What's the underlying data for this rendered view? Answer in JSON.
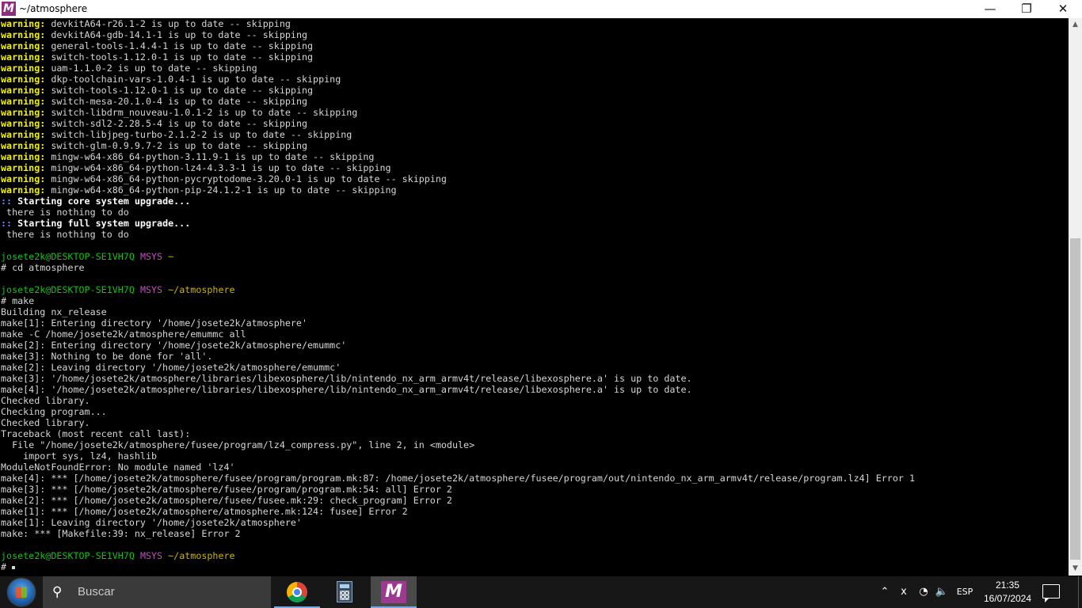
{
  "window": {
    "title": "~/atmosphere",
    "app_icon": "msys2-icon",
    "controls": {
      "minimize": "—",
      "maximize": "❐",
      "close": "✕"
    }
  },
  "terminal": {
    "lines": [
      {
        "parts": [
          {
            "cls": "w",
            "text": "warning:"
          },
          {
            "cls": "",
            "text": " devkitA64-r26.1-2 is up to date -- skipping"
          }
        ]
      },
      {
        "parts": [
          {
            "cls": "w",
            "text": "warning:"
          },
          {
            "cls": "",
            "text": " devkitA64-gdb-14.1-1 is up to date -- skipping"
          }
        ]
      },
      {
        "parts": [
          {
            "cls": "w",
            "text": "warning:"
          },
          {
            "cls": "",
            "text": " general-tools-1.4.4-1 is up to date -- skipping"
          }
        ]
      },
      {
        "parts": [
          {
            "cls": "w",
            "text": "warning:"
          },
          {
            "cls": "",
            "text": " switch-tools-1.12.0-1 is up to date -- skipping"
          }
        ]
      },
      {
        "parts": [
          {
            "cls": "w",
            "text": "warning:"
          },
          {
            "cls": "",
            "text": " uam-1.1.0-2 is up to date -- skipping"
          }
        ]
      },
      {
        "parts": [
          {
            "cls": "w",
            "text": "warning:"
          },
          {
            "cls": "",
            "text": " dkp-toolchain-vars-1.0.4-1 is up to date -- skipping"
          }
        ]
      },
      {
        "parts": [
          {
            "cls": "w",
            "text": "warning:"
          },
          {
            "cls": "",
            "text": " switch-tools-1.12.0-1 is up to date -- skipping"
          }
        ]
      },
      {
        "parts": [
          {
            "cls": "w",
            "text": "warning:"
          },
          {
            "cls": "",
            "text": " switch-mesa-20.1.0-4 is up to date -- skipping"
          }
        ]
      },
      {
        "parts": [
          {
            "cls": "w",
            "text": "warning:"
          },
          {
            "cls": "",
            "text": " switch-libdrm_nouveau-1.0.1-2 is up to date -- skipping"
          }
        ]
      },
      {
        "parts": [
          {
            "cls": "w",
            "text": "warning:"
          },
          {
            "cls": "",
            "text": " switch-sdl2-2.28.5-4 is up to date -- skipping"
          }
        ]
      },
      {
        "parts": [
          {
            "cls": "w",
            "text": "warning:"
          },
          {
            "cls": "",
            "text": " switch-libjpeg-turbo-2.1.2-2 is up to date -- skipping"
          }
        ]
      },
      {
        "parts": [
          {
            "cls": "w",
            "text": "warning:"
          },
          {
            "cls": "",
            "text": " switch-glm-0.9.9.7-2 is up to date -- skipping"
          }
        ]
      },
      {
        "parts": [
          {
            "cls": "w",
            "text": "warning:"
          },
          {
            "cls": "",
            "text": " mingw-w64-x86_64-python-3.11.9-1 is up to date -- skipping"
          }
        ]
      },
      {
        "parts": [
          {
            "cls": "w",
            "text": "warning:"
          },
          {
            "cls": "",
            "text": " mingw-w64-x86_64-python-lz4-4.3.3-1 is up to date -- skipping"
          }
        ]
      },
      {
        "parts": [
          {
            "cls": "w",
            "text": "warning:"
          },
          {
            "cls": "",
            "text": " mingw-w64-x86_64-python-pycryptodome-3.20.0-1 is up to date -- skipping"
          }
        ]
      },
      {
        "parts": [
          {
            "cls": "w",
            "text": "warning:"
          },
          {
            "cls": "",
            "text": " mingw-w64-x86_64-python-pip-24.1.2-1 is up to date -- skipping"
          }
        ]
      },
      {
        "parts": [
          {
            "cls": "blue",
            "text": "::"
          },
          {
            "cls": "b",
            "text": " Starting core system upgrade..."
          }
        ]
      },
      {
        "parts": [
          {
            "cls": "",
            "text": " there is nothing to do"
          }
        ]
      },
      {
        "parts": [
          {
            "cls": "blue",
            "text": "::"
          },
          {
            "cls": "b",
            "text": " Starting full system upgrade..."
          }
        ]
      },
      {
        "parts": [
          {
            "cls": "",
            "text": " there is nothing to do"
          }
        ]
      },
      {
        "parts": []
      },
      {
        "parts": [
          {
            "cls": "g",
            "text": "josete2k@DESKTOP-SE1VH7Q"
          },
          {
            "cls": "",
            "text": " "
          },
          {
            "cls": "m",
            "text": "MSYS"
          },
          {
            "cls": "",
            "text": " "
          },
          {
            "cls": "y",
            "text": "~"
          }
        ]
      },
      {
        "parts": [
          {
            "cls": "",
            "text": "# cd atmosphere"
          }
        ]
      },
      {
        "parts": []
      },
      {
        "parts": [
          {
            "cls": "g",
            "text": "josete2k@DESKTOP-SE1VH7Q"
          },
          {
            "cls": "",
            "text": " "
          },
          {
            "cls": "m",
            "text": "MSYS"
          },
          {
            "cls": "",
            "text": " "
          },
          {
            "cls": "y",
            "text": "~/atmosphere"
          }
        ]
      },
      {
        "parts": [
          {
            "cls": "",
            "text": "# make"
          }
        ]
      },
      {
        "parts": [
          {
            "cls": "",
            "text": "Building nx_release"
          }
        ]
      },
      {
        "parts": [
          {
            "cls": "",
            "text": "make[1]: Entering directory '/home/josete2k/atmosphere'"
          }
        ]
      },
      {
        "parts": [
          {
            "cls": "",
            "text": "make -C /home/josete2k/atmosphere/emummc all"
          }
        ]
      },
      {
        "parts": [
          {
            "cls": "",
            "text": "make[2]: Entering directory '/home/josete2k/atmosphere/emummc'"
          }
        ]
      },
      {
        "parts": [
          {
            "cls": "",
            "text": "make[3]: Nothing to be done for 'all'."
          }
        ]
      },
      {
        "parts": [
          {
            "cls": "",
            "text": "make[2]: Leaving directory '/home/josete2k/atmosphere/emummc'"
          }
        ]
      },
      {
        "parts": [
          {
            "cls": "",
            "text": "make[3]: '/home/josete2k/atmosphere/libraries/libexosphere/lib/nintendo_nx_arm_armv4t/release/libexosphere.a' is up to date."
          }
        ]
      },
      {
        "parts": [
          {
            "cls": "",
            "text": "make[4]: '/home/josete2k/atmosphere/libraries/libexosphere/lib/nintendo_nx_arm_armv4t/release/libexosphere.a' is up to date."
          }
        ]
      },
      {
        "parts": [
          {
            "cls": "",
            "text": "Checked library."
          }
        ]
      },
      {
        "parts": [
          {
            "cls": "",
            "text": "Checking program..."
          }
        ]
      },
      {
        "parts": [
          {
            "cls": "",
            "text": "Checked library."
          }
        ]
      },
      {
        "parts": [
          {
            "cls": "",
            "text": "Traceback (most recent call last):"
          }
        ]
      },
      {
        "parts": [
          {
            "cls": "",
            "text": "  File \"/home/josete2k/atmosphere/fusee/program/lz4_compress.py\", line 2, in <module>"
          }
        ]
      },
      {
        "parts": [
          {
            "cls": "",
            "text": "    import sys, lz4, hashlib"
          }
        ]
      },
      {
        "parts": [
          {
            "cls": "",
            "text": "ModuleNotFoundError: No module named 'lz4'"
          }
        ]
      },
      {
        "parts": [
          {
            "cls": "",
            "text": "make[4]: *** [/home/josete2k/atmosphere/fusee/program/program.mk:87: /home/josete2k/atmosphere/fusee/program/out/nintendo_nx_arm_armv4t/release/program.lz4] Error 1"
          }
        ]
      },
      {
        "parts": [
          {
            "cls": "",
            "text": "make[3]: *** [/home/josete2k/atmosphere/fusee/program/program.mk:54: all] Error 2"
          }
        ]
      },
      {
        "parts": [
          {
            "cls": "",
            "text": "make[2]: *** [/home/josete2k/atmosphere/fusee/fusee.mk:29: check_program] Error 2"
          }
        ]
      },
      {
        "parts": [
          {
            "cls": "",
            "text": "make[1]: *** [/home/josete2k/atmosphere/atmosphere.mk:124: fusee] Error 2"
          }
        ]
      },
      {
        "parts": [
          {
            "cls": "",
            "text": "make[1]: Leaving directory '/home/josete2k/atmosphere'"
          }
        ]
      },
      {
        "parts": [
          {
            "cls": "",
            "text": "make: *** [Makefile:39: nx_release] Error 2"
          }
        ]
      },
      {
        "parts": []
      },
      {
        "parts": [
          {
            "cls": "g",
            "text": "josete2k@DESKTOP-SE1VH7Q"
          },
          {
            "cls": "",
            "text": " "
          },
          {
            "cls": "m",
            "text": "MSYS"
          },
          {
            "cls": "",
            "text": " "
          },
          {
            "cls": "y",
            "text": "~/atmosphere"
          }
        ]
      },
      {
        "parts": [
          {
            "cls": "",
            "text": "# "
          }
        ],
        "cursor": true
      }
    ]
  },
  "scrollbar": {
    "up_icon": "▲",
    "down_icon": "▼",
    "position_fraction": 1.0
  },
  "taskbar": {
    "search_placeholder": "Buscar",
    "search_icon": "⚲",
    "apps": [
      {
        "name": "chrome-icon",
        "state": "running"
      },
      {
        "name": "calculator-icon",
        "state": "normal"
      },
      {
        "name": "msys2-icon",
        "state": "active"
      }
    ],
    "tray": {
      "chevron": "⌃",
      "ime": "ⅹ",
      "network": "◔",
      "volume": "🔈",
      "language": "ESP",
      "time": "21:35",
      "date": "16/07/2024"
    }
  }
}
